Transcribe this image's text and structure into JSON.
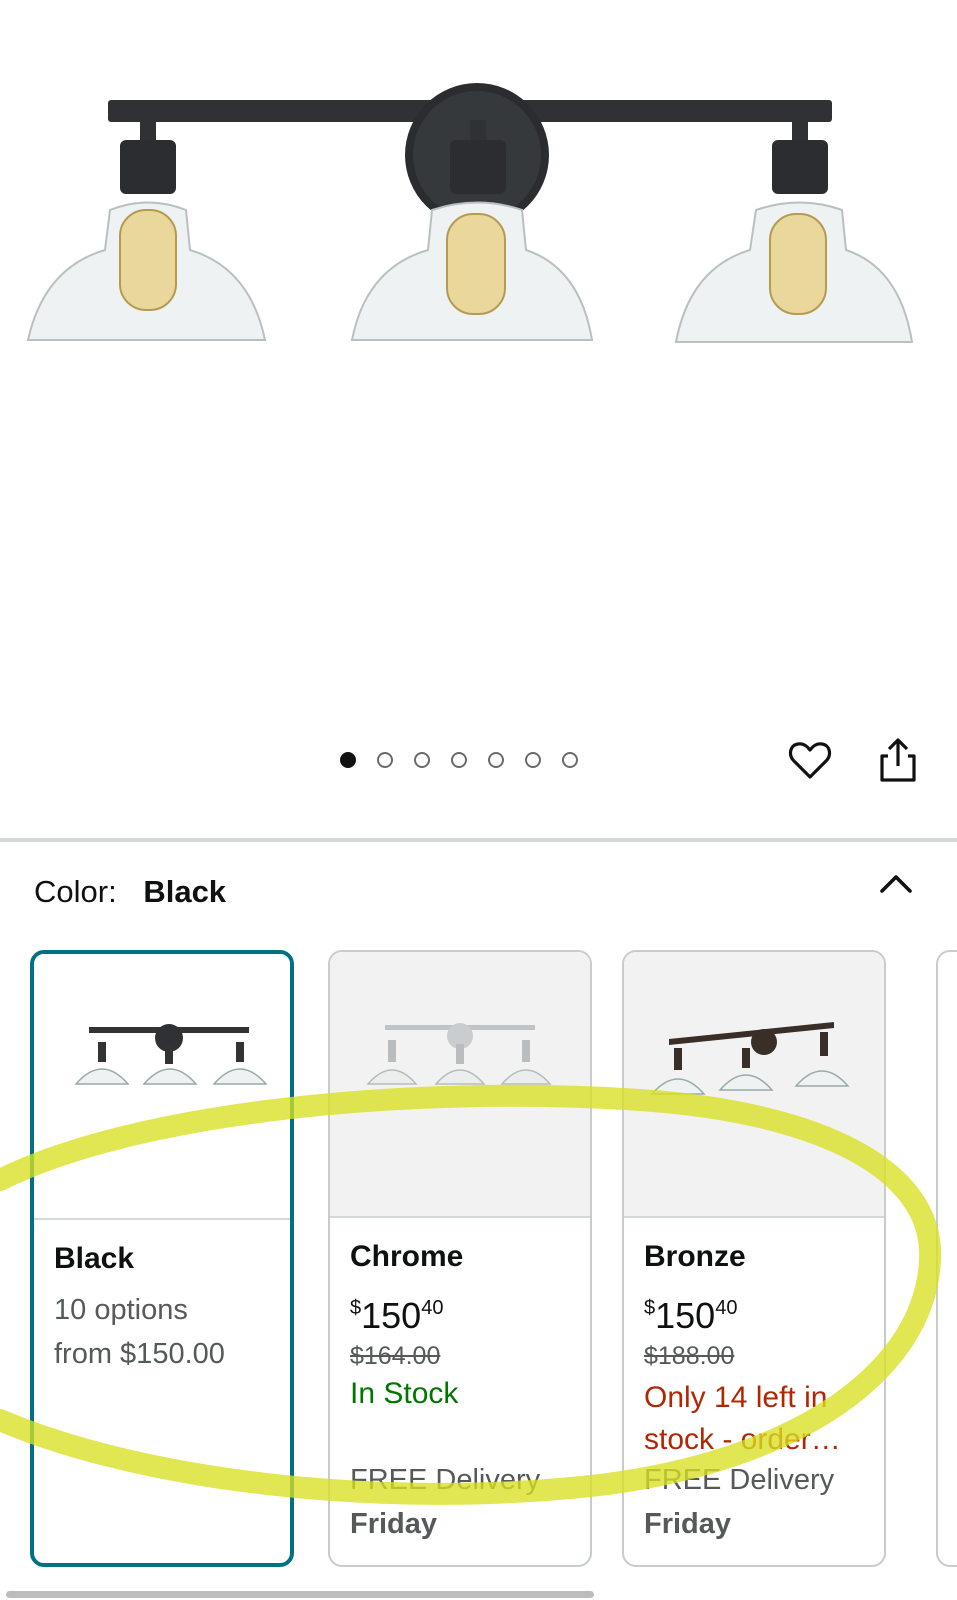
{
  "carousel": {
    "dot_count": 7,
    "active_index": 0
  },
  "color_section": {
    "label": "Color:",
    "selected_value": "Black"
  },
  "options": [
    {
      "name": "Black",
      "line1": "10 options",
      "line2": "from $150.00"
    },
    {
      "name": "Chrome",
      "price_whole": "150",
      "price_fraction": "40",
      "currency": "$",
      "list_price": "$164.00",
      "stock": "In Stock",
      "delivery": "FREE Delivery",
      "delivery_day": "Friday"
    },
    {
      "name": "Bronze",
      "price_whole": "150",
      "price_fraction": "40",
      "currency": "$",
      "list_price": "$188.00",
      "stock": "Only 14 left in stock - order…",
      "delivery": "FREE Delivery",
      "delivery_day": "Friday"
    }
  ],
  "colors": {
    "accent": "#007185",
    "in_stock": "#007600",
    "low_stock": "#b12704",
    "annotation": "#d9e021"
  },
  "icons": [
    "heart-icon",
    "share-icon",
    "chevron-up-icon"
  ]
}
